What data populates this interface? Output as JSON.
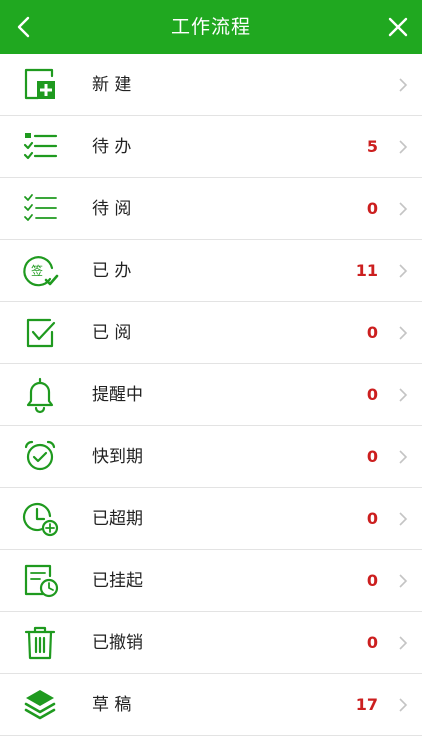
{
  "header": {
    "title": "工作流程",
    "background": "#20a820"
  },
  "items": [
    {
      "label": "新 建",
      "count": "",
      "icon": "new-document-icon"
    },
    {
      "label": "待 办",
      "count": "5",
      "icon": "todo-list-icon"
    },
    {
      "label": "待 阅",
      "count": "0",
      "icon": "checklist-icon"
    },
    {
      "label": "已 办",
      "count": "11",
      "icon": "signed-stamp-icon"
    },
    {
      "label": "已 阅",
      "count": "0",
      "icon": "checked-box-icon"
    },
    {
      "label": "提醒中",
      "count": "0",
      "icon": "bell-icon"
    },
    {
      "label": "快到期",
      "count": "0",
      "icon": "alarm-clock-icon"
    },
    {
      "label": "已超期",
      "count": "0",
      "icon": "overdue-clock-icon"
    },
    {
      "label": "已挂起",
      "count": "0",
      "icon": "suspended-document-icon"
    },
    {
      "label": "已撤销",
      "count": "0",
      "icon": "trash-icon"
    },
    {
      "label": "草 稿",
      "count": "17",
      "icon": "layers-icon"
    }
  ],
  "icon_text": {
    "signed": "签"
  },
  "colors": {
    "accent": "#1f9a1f",
    "count": "#cc1f1f"
  }
}
